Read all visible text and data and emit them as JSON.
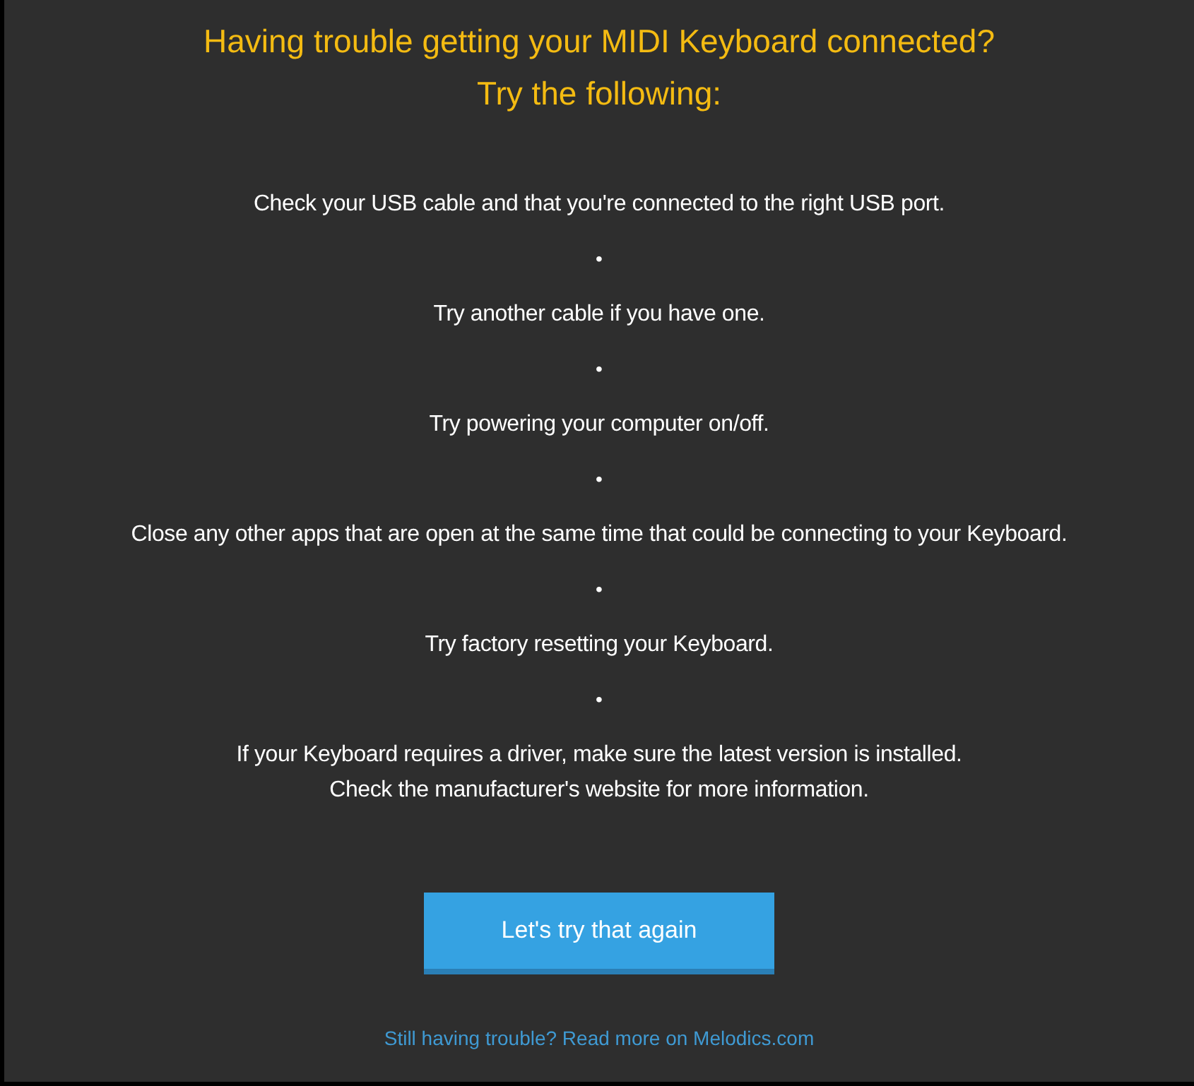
{
  "heading": "Having trouble getting your MIDI Keyboard connected?\nTry the following:",
  "lines": [
    {
      "kind": "step",
      "text": "Check your USB cable and that you're connected to the right USB port."
    },
    {
      "kind": "bullet",
      "text": "•"
    },
    {
      "kind": "step",
      "text": "Try another cable if you have one."
    },
    {
      "kind": "bullet",
      "text": "•"
    },
    {
      "kind": "step",
      "text": "Try powering your computer on/off."
    },
    {
      "kind": "bullet",
      "text": "•"
    },
    {
      "kind": "step",
      "text": "Close any other apps that are open at the same time that could be connecting to your Keyboard."
    },
    {
      "kind": "bullet",
      "text": "•"
    },
    {
      "kind": "step",
      "text": "Try factory resetting your Keyboard."
    },
    {
      "kind": "bullet",
      "text": "•"
    },
    {
      "kind": "step",
      "text": "If your Keyboard requires a driver, make sure the latest version is installed.\nCheck the manufacturer's website for more information."
    }
  ],
  "button": "Let's try that again",
  "link": "Still having trouble? Read more on Melodics.com"
}
